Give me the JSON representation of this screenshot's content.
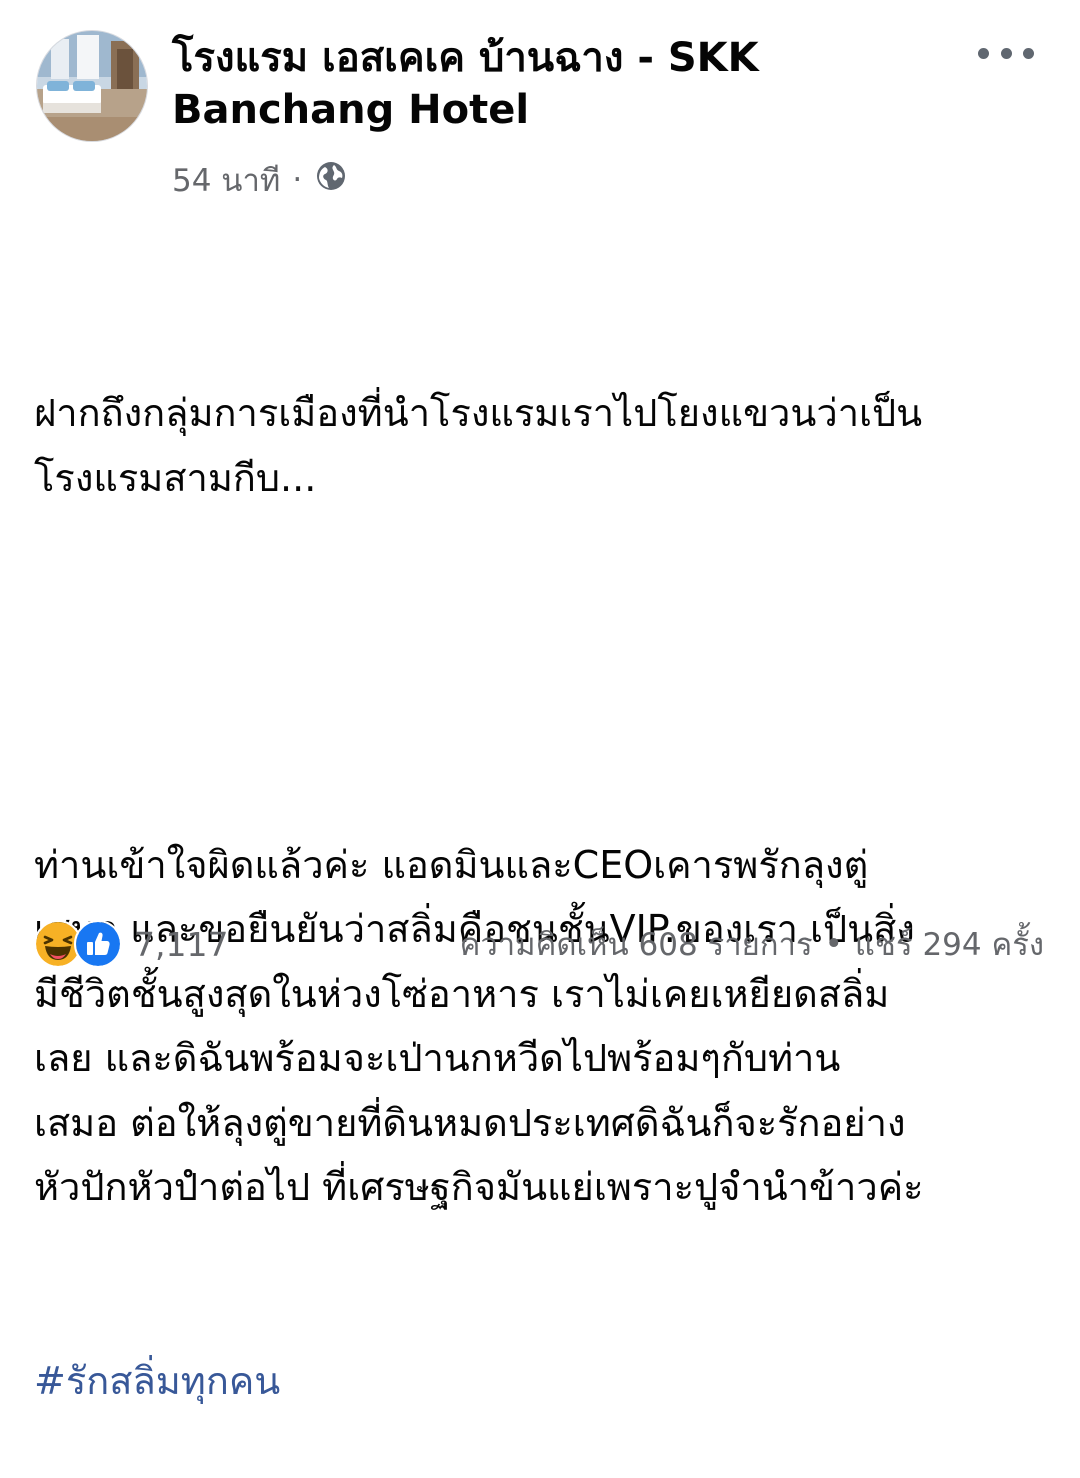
{
  "post": {
    "author": "โรงแรม เอสเคเค บ้านฉาง - SKK Banchang Hotel",
    "timestamp": "54 นาที",
    "meta_separator": "·",
    "privacy_icon": "globe-icon",
    "paragraph1": "ฝากถึงกลุ่มการเมืองที่นำโรงแรมเราไปโยงแขวนว่าเป็น\nโรงแรมสามกีบ...",
    "paragraph2": "ท่านเข้าใจผิดแล้วค่ะ แอดมินและCEOเคารพรักลุงตู่\nเสมอ และขอยืนยันว่าสลิ่มคือชนชั้นVIP.ของเรา เป็นสิ่ง\nมีชีวิตชั้นสูงสุดในห่วงโซ่อาหาร เราไม่เคยเหยียดสลิ่ม\nเลย และดิฉันพร้อมจะเป่านกหวีดไปพร้อมๆกับท่าน\nเสมอ ต่อให้ลุงตู่ขายที่ดินหมดประเทศดิฉันก็จะรักอย่าง\nหัวปักหัวปำต่อไป ที่เศรษฐกิจมันแย่เพราะปูจำนำข้าวค่ะ",
    "hashtag": "#รักสลิ่มทุกคน"
  },
  "reactions": {
    "icons": [
      "haha-icon",
      "like-icon"
    ],
    "count": "7,117"
  },
  "stats": {
    "comments": "ความคิดเห็น 608 รายการ",
    "bullet": "•",
    "shares": "แชร์ 294 ครั้ง"
  },
  "colors": {
    "hashtag": "#385898",
    "secondary_text": "#65676b",
    "like_blue": "#1877f2",
    "haha_yellow": "#f7b125"
  }
}
